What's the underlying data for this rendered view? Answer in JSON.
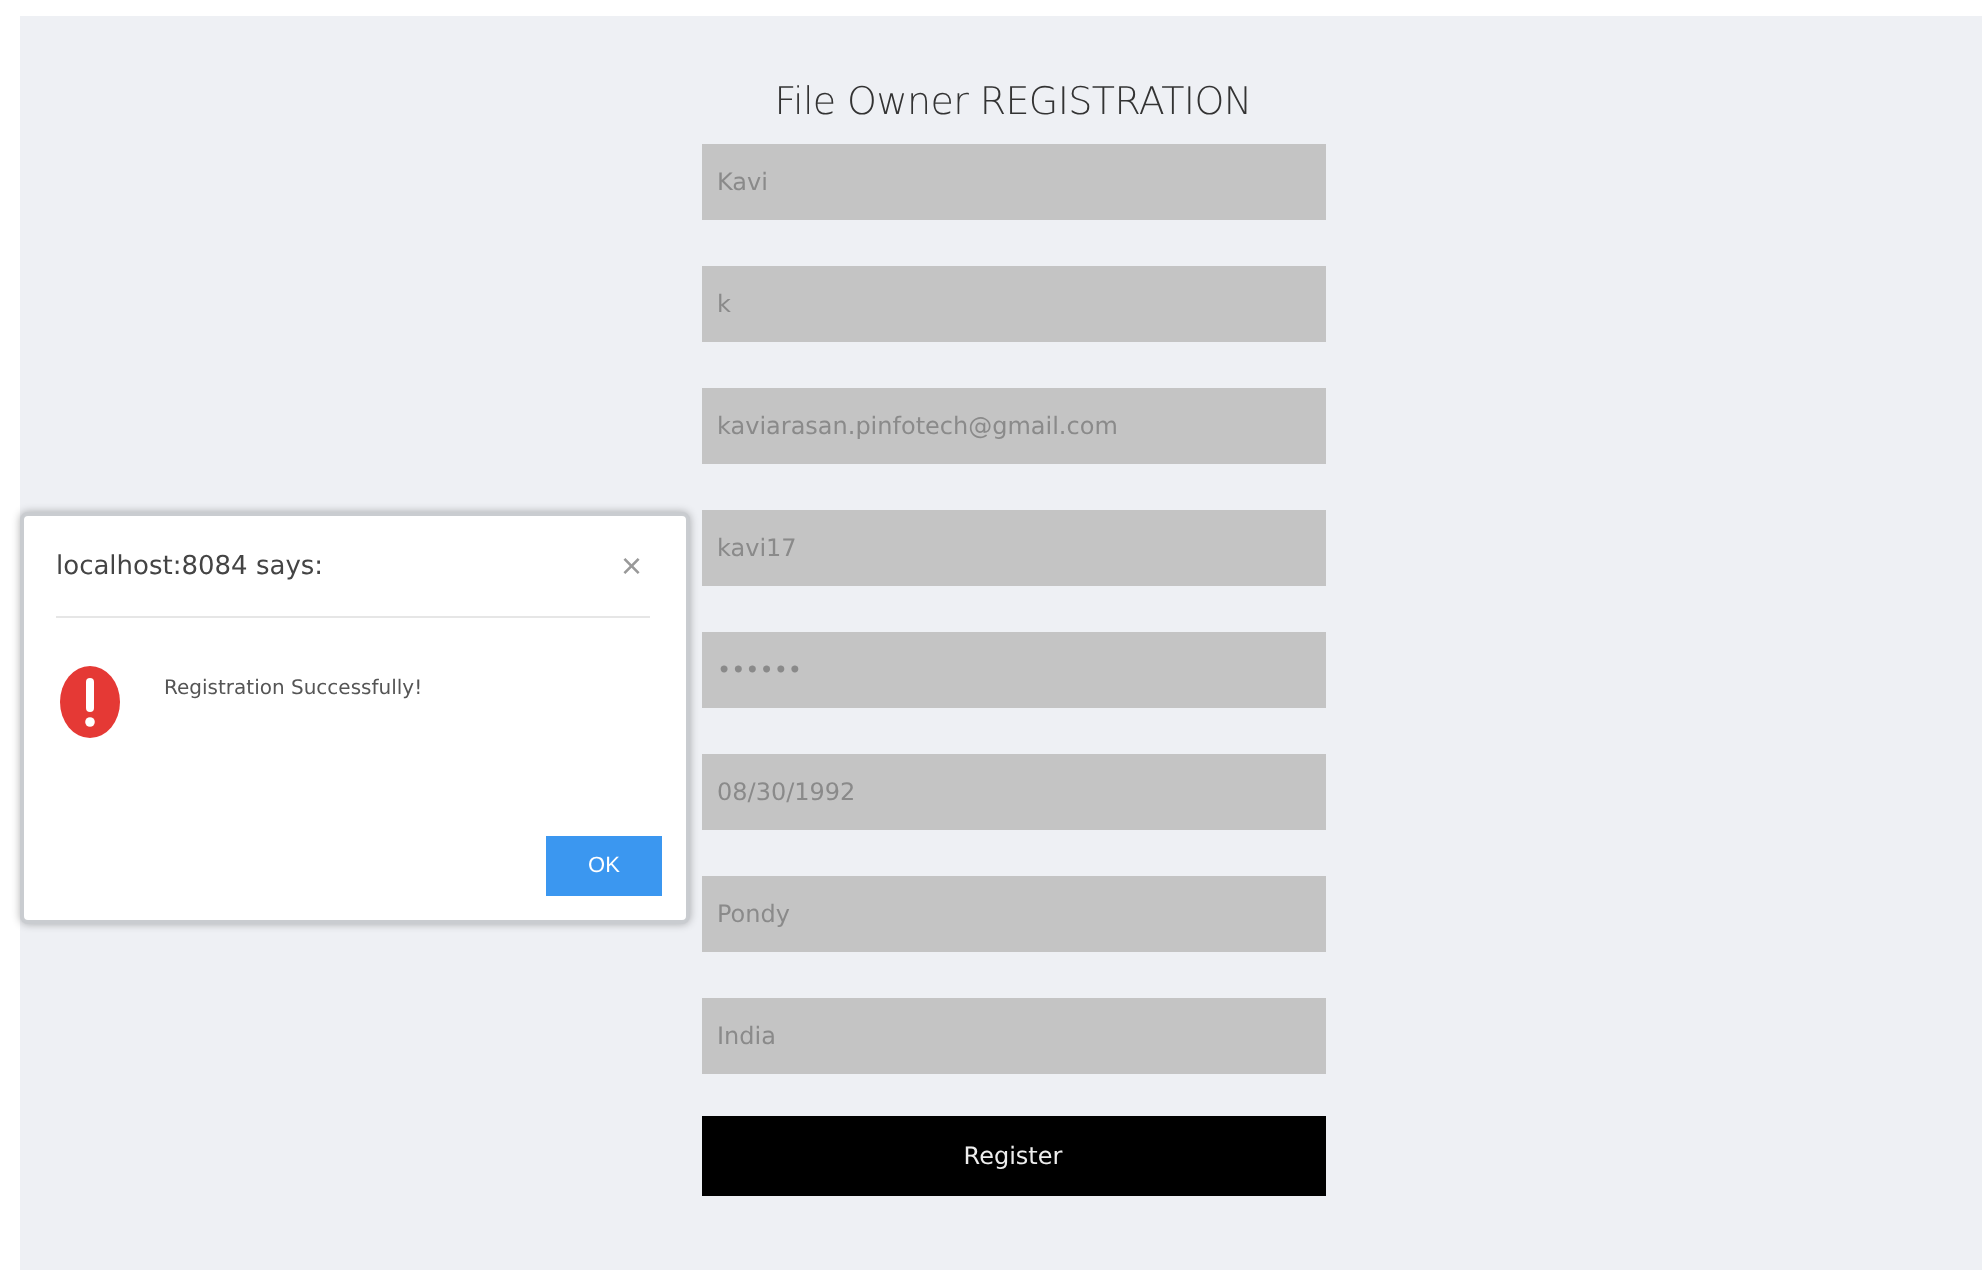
{
  "form": {
    "title": "File Owner REGISTRATION",
    "fields": [
      {
        "value": "Kavi"
      },
      {
        "value": "k"
      },
      {
        "value": "kaviarasan.pinfotech@gmail.com"
      },
      {
        "value": "kavi17"
      },
      {
        "value": "••••••"
      },
      {
        "value": "08/30/1992"
      },
      {
        "value": "Pondy"
      },
      {
        "value": "India"
      }
    ],
    "submit": "Register"
  },
  "dialog": {
    "title": "localhost:8084 says:",
    "close": "×",
    "message": "Registration Successfully!",
    "button": "OK"
  }
}
